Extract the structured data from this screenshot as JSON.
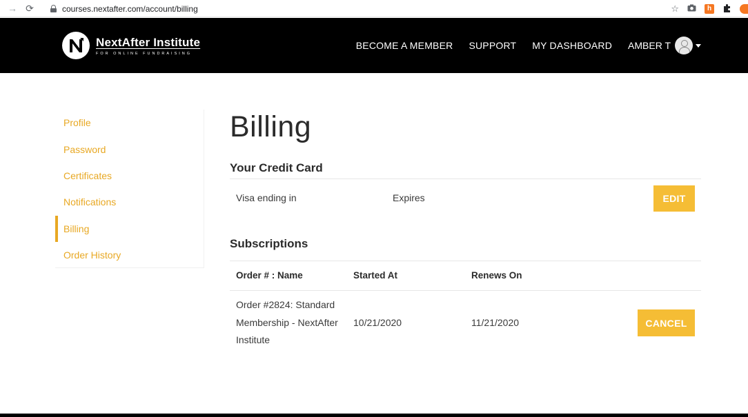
{
  "browser": {
    "url": "courses.nextafter.com/account/billing",
    "ext_badge": "h"
  },
  "header": {
    "brand_title": "NextAfter Institute",
    "brand_subtitle": "FOR ONLINE FUNDRAISING",
    "nav": [
      "BECOME A MEMBER",
      "SUPPORT",
      "MY DASHBOARD"
    ],
    "user_name": "AMBER T"
  },
  "sidebar": {
    "items": [
      {
        "label": "Profile"
      },
      {
        "label": "Password"
      },
      {
        "label": "Certificates"
      },
      {
        "label": "Notifications"
      },
      {
        "label": "Billing",
        "active": true
      },
      {
        "label": "Order History"
      }
    ]
  },
  "main": {
    "title": "Billing",
    "credit_card": {
      "heading": "Your Credit Card",
      "card_text": "Visa ending in",
      "expires_text": "Expires",
      "edit_label": "EDIT"
    },
    "subscriptions": {
      "heading": "Subscriptions",
      "columns": [
        "Order # : Name",
        "Started At",
        "Renews On"
      ],
      "rows": [
        {
          "order_name": "Order #2824: Standard Membership - NextAfter Institute",
          "started_at": "10/21/2020",
          "renews_on": "11/21/2020",
          "action_label": "CANCEL"
        }
      ]
    }
  },
  "colors": {
    "accent": "#e8a823",
    "button": "#f5bd35",
    "header_bg": "#000000"
  }
}
